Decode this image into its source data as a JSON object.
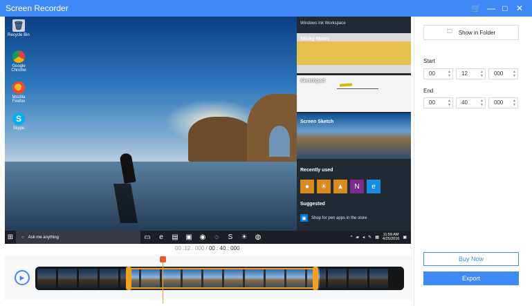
{
  "window": {
    "title": "Screen Recorder",
    "controls": {
      "cart": "🛒",
      "minimize": "—",
      "maximize": "□",
      "close": "✕"
    }
  },
  "preview": {
    "desktop_icons": [
      {
        "label": "Recycle Bin",
        "icon": "recycle-bin-icon",
        "glyph": "🗑"
      },
      {
        "label": "Google Chrome",
        "icon": "chrome-icon",
        "glyph": ""
      },
      {
        "label": "Mozilla Firefox",
        "icon": "firefox-icon",
        "glyph": ""
      },
      {
        "label": "Skype",
        "icon": "skype-icon",
        "glyph": "S"
      }
    ],
    "ink_workspace": {
      "header": "Windows Ink Workspace",
      "sticky_notes": "Sticky Notes",
      "sketchpad": "Sketchpad",
      "screen_sketch": "Screen Sketch",
      "recently_used": "Recently used",
      "suggested": "Suggested",
      "suggestion_text": "Shop for pen apps in the store"
    },
    "taskbar": {
      "search_placeholder": "Ask me anything",
      "time": "11:59 AM",
      "date": "4/25/2016"
    }
  },
  "timeline": {
    "current_time": "00 :12 : 000",
    "separator": " / ",
    "total_time": "00 : 40 : 000"
  },
  "sidebar": {
    "show_in_folder": "Show in Folder",
    "start_label": "Start",
    "end_label": "End",
    "start": {
      "hours": "00",
      "minutes": "12",
      "millis": "000"
    },
    "end": {
      "hours": "00",
      "minutes": "40",
      "millis": "000"
    },
    "buy_now": "Buy Now",
    "export": "Export"
  },
  "colors": {
    "accent": "#3f89f7",
    "selection": "#f3a021",
    "playhead": "#ea5b2b"
  }
}
